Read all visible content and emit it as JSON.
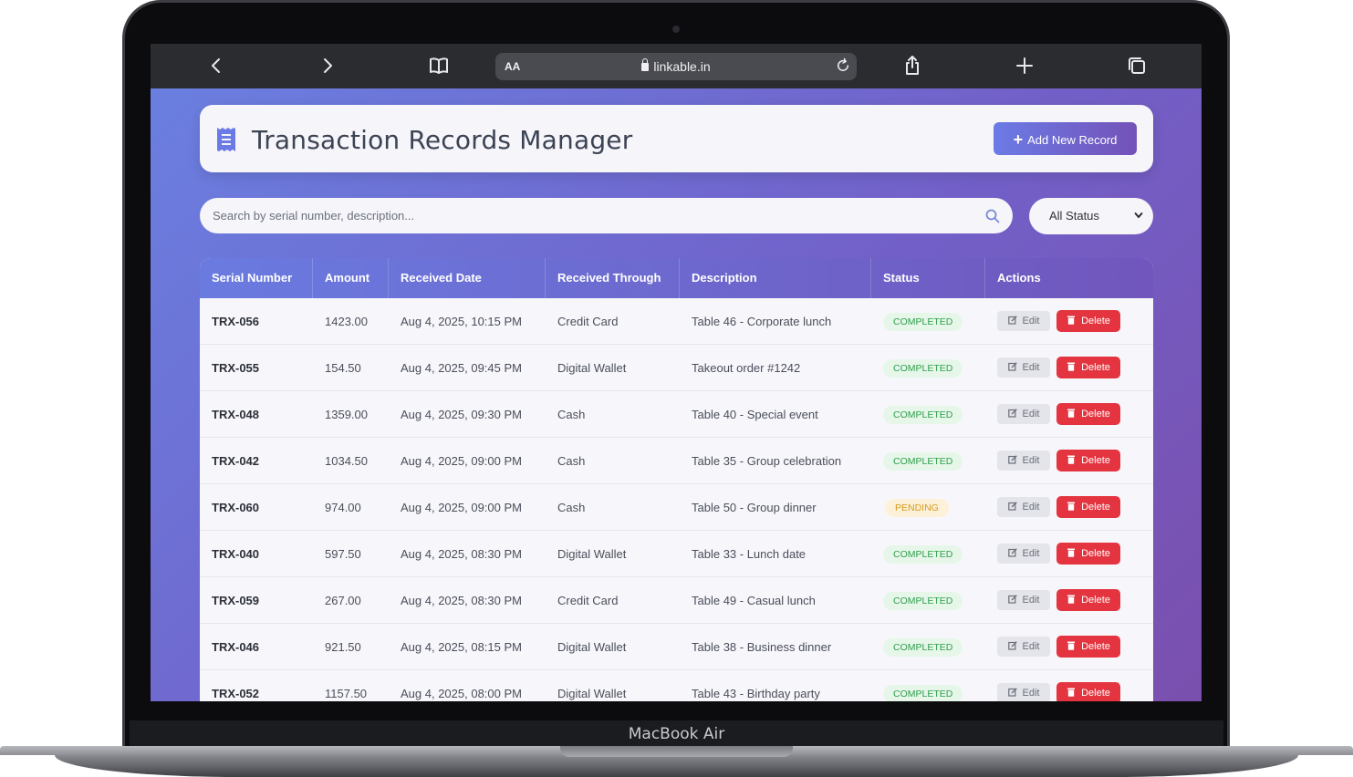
{
  "device": {
    "label": "MacBook Air"
  },
  "browser": {
    "aa_label": "AA",
    "url": "linkable.in",
    "icons": [
      "back-icon",
      "forward-icon",
      "bookmarks-icon",
      "lock-icon",
      "reload-icon",
      "share-icon",
      "new-tab-icon",
      "tabs-icon"
    ]
  },
  "header": {
    "icon": "receipt-icon",
    "title": "Transaction Records Manager",
    "add_button": "Add New Record"
  },
  "filters": {
    "search_placeholder": "Search by serial number, description...",
    "status_selected": "All Status"
  },
  "table": {
    "columns": [
      "Serial Number",
      "Amount",
      "Received Date",
      "Received Through",
      "Description",
      "Status",
      "Actions"
    ],
    "edit_label": "Edit",
    "delete_label": "Delete",
    "rows": [
      {
        "serial": "TRX-056",
        "amount": "1423.00",
        "date": "Aug 4, 2025, 10:15 PM",
        "through": "Credit Card",
        "description": "Table 46 - Corporate lunch",
        "status": "COMPLETED"
      },
      {
        "serial": "TRX-055",
        "amount": "154.50",
        "date": "Aug 4, 2025, 09:45 PM",
        "through": "Digital Wallet",
        "description": "Takeout order #1242",
        "status": "COMPLETED"
      },
      {
        "serial": "TRX-048",
        "amount": "1359.00",
        "date": "Aug 4, 2025, 09:30 PM",
        "through": "Cash",
        "description": "Table 40 - Special event",
        "status": "COMPLETED"
      },
      {
        "serial": "TRX-042",
        "amount": "1034.50",
        "date": "Aug 4, 2025, 09:00 PM",
        "through": "Cash",
        "description": "Table 35 - Group celebration",
        "status": "COMPLETED"
      },
      {
        "serial": "TRX-060",
        "amount": "974.00",
        "date": "Aug 4, 2025, 09:00 PM",
        "through": "Cash",
        "description": "Table 50 - Group dinner",
        "status": "PENDING"
      },
      {
        "serial": "TRX-040",
        "amount": "597.50",
        "date": "Aug 4, 2025, 08:30 PM",
        "through": "Digital Wallet",
        "description": "Table 33 - Lunch date",
        "status": "COMPLETED"
      },
      {
        "serial": "TRX-059",
        "amount": "267.00",
        "date": "Aug 4, 2025, 08:30 PM",
        "through": "Credit Card",
        "description": "Table 49 - Casual lunch",
        "status": "COMPLETED"
      },
      {
        "serial": "TRX-046",
        "amount": "921.50",
        "date": "Aug 4, 2025, 08:15 PM",
        "through": "Digital Wallet",
        "description": "Table 38 - Business dinner",
        "status": "COMPLETED"
      },
      {
        "serial": "TRX-052",
        "amount": "1157.50",
        "date": "Aug 4, 2025, 08:00 PM",
        "through": "Digital Wallet",
        "description": "Table 43 - Birthday party",
        "status": "COMPLETED"
      }
    ]
  },
  "colors": {
    "accent": "#6b7be6",
    "accent_dark": "#7452b8",
    "completed": "#2f9e4a",
    "pending": "#d49a1c",
    "delete": "#e3343f"
  }
}
